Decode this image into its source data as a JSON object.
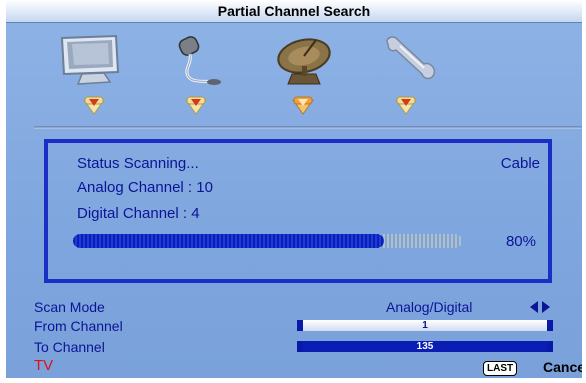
{
  "title": "Partial Channel Search",
  "menu_icons": [
    {
      "icon": "monitor-icon"
    },
    {
      "icon": "audio-icon"
    },
    {
      "icon": "satellite-dish-icon"
    },
    {
      "icon": "wrench-icon"
    }
  ],
  "status": {
    "text": "Status Scanning...",
    "source_type": "Cable",
    "analog": "Analog Channel : 10",
    "digital": "Digital Channel : 4",
    "progress_label": "80%",
    "progress_fraction": 0.8
  },
  "settings": {
    "scan_mode_label": "Scan Mode",
    "scan_mode_value": "Analog/Digital",
    "from_label": "From Channel",
    "from_value": "1",
    "to_label": "To Channel",
    "to_value": "135"
  },
  "footer": {
    "source": "TV",
    "last_key": "LAST",
    "cancel": "Cancel"
  },
  "colors": {
    "background": "#7fa6de",
    "text": "#0b1496",
    "accent": "#1b2fc4",
    "source_label": "#e01010",
    "selected_marker": "#f2a13a",
    "marker": "#f4e6a8"
  }
}
